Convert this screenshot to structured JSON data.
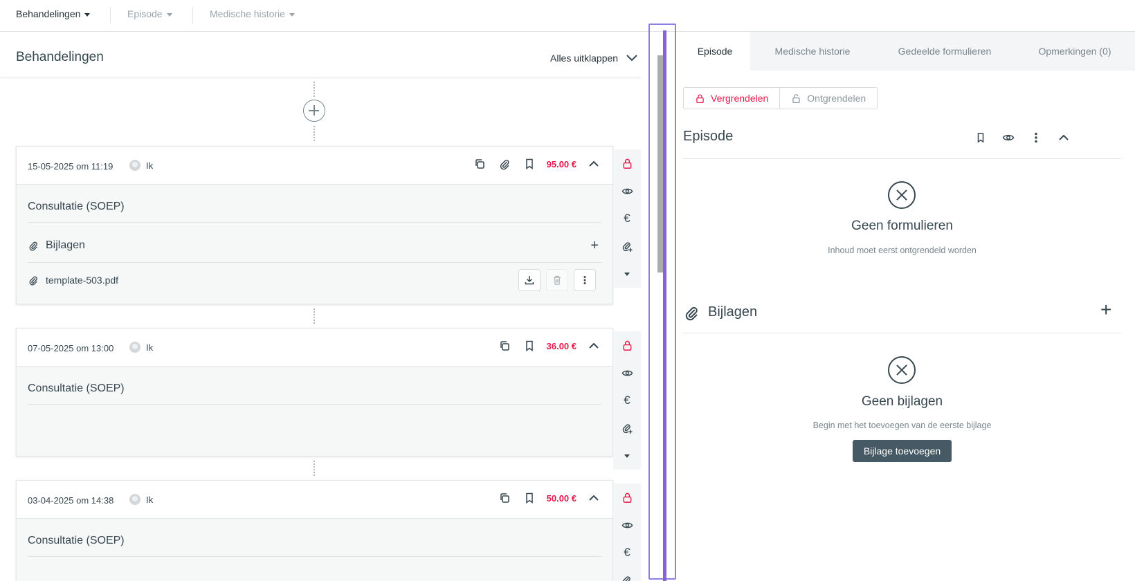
{
  "topnav": {
    "items": [
      {
        "label": "Behandelingen"
      },
      {
        "label": "Episode"
      },
      {
        "label": "Medische historie"
      }
    ]
  },
  "left": {
    "title": "Behandelingen",
    "expand_all": "Alles uitklappen",
    "cards": [
      {
        "date": "15-05-2025 om 11:19",
        "user": "Ik",
        "price": "95.00 €",
        "title": "Consultatie (SOEP)",
        "attachments_label": "Bijlagen",
        "file": "template-503.pdf"
      },
      {
        "date": "07-05-2025 om 13:00",
        "user": "Ik",
        "price": "36.00 €",
        "title": "Consultatie (SOEP)"
      },
      {
        "date": "03-04-2025 om 14:38",
        "user": "Ik",
        "price": "50.00 €",
        "title": "Consultatie (SOEP)"
      }
    ]
  },
  "right": {
    "tabs": [
      {
        "label": "Episode"
      },
      {
        "label": "Medische historie"
      },
      {
        "label": "Gedeelde formulieren"
      },
      {
        "label": "Opmerkingen (0)"
      }
    ],
    "lock_label": "Vergrendelen",
    "unlock_label": "Ontgrendelen",
    "episode": {
      "title": "Episode",
      "empty_title": "Geen formulieren",
      "empty_sub": "Inhoud moet eerst ontgrendeld worden"
    },
    "attachments": {
      "title": "Bijlagen",
      "empty_title": "Geen bijlagen",
      "empty_sub": "Begin met het toevoegen van de eerste bijlage",
      "add_button": "Bijlage toevoegen"
    }
  },
  "colors": {
    "price": "#e8174a",
    "lock": "#e8174a",
    "primary_button": "#455a64",
    "splitter": "#8a63d2"
  }
}
